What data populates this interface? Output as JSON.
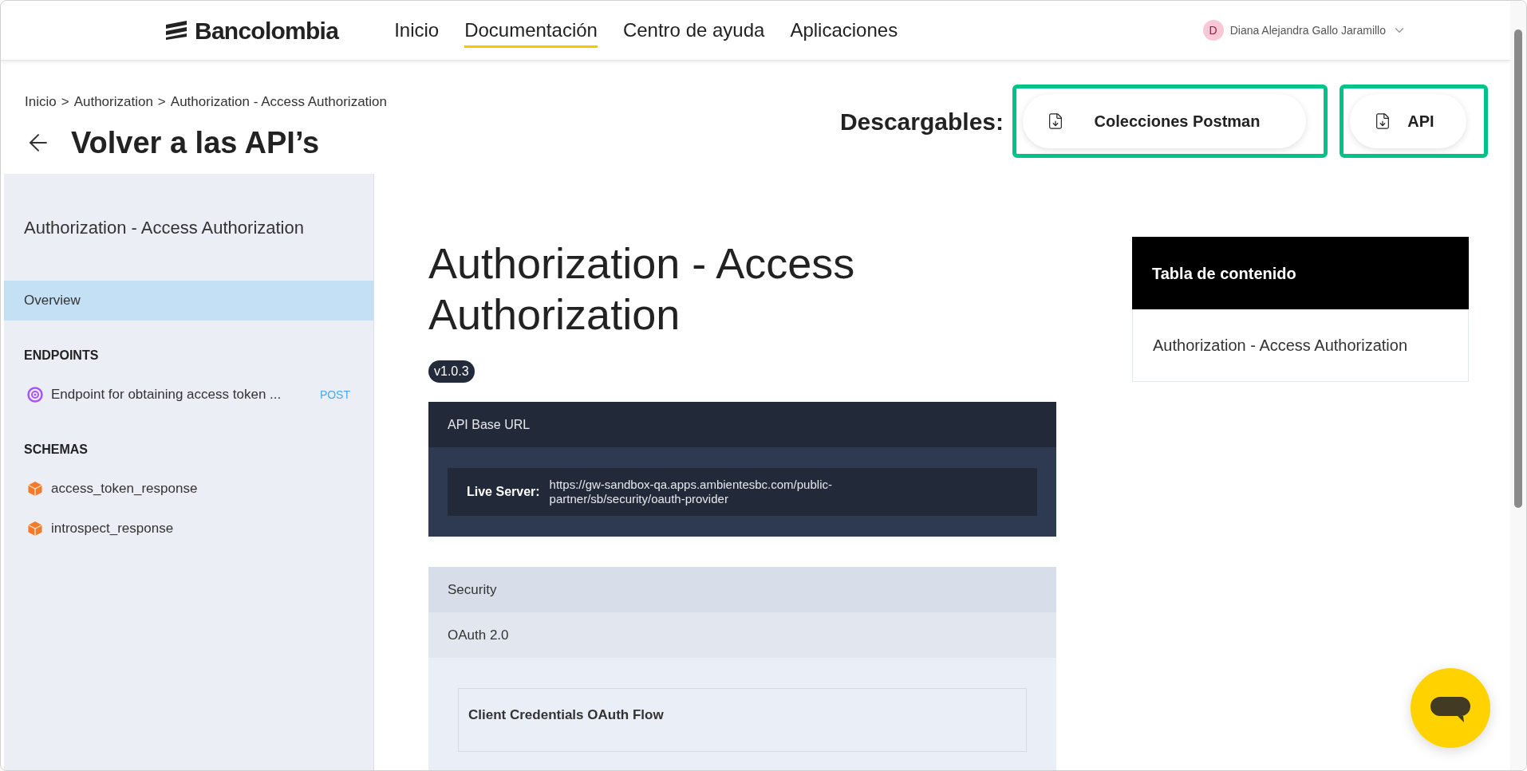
{
  "logo": "Bancolombia",
  "nav": [
    {
      "label": "Inicio",
      "selected": false
    },
    {
      "label": "Documentación",
      "selected": true
    },
    {
      "label": "Centro de ayuda",
      "selected": false
    },
    {
      "label": "Aplicaciones",
      "selected": false
    }
  ],
  "user": {
    "initial": "D",
    "name": "Diana Alejandra Gallo Jaramillo"
  },
  "breadcrumb": {
    "separator": ">",
    "items": [
      "Inicio",
      "Authorization",
      "Authorization - Access Authorization"
    ]
  },
  "back_title": "Volver a las API’s",
  "downloads": {
    "label": "Descargables:",
    "buttons": [
      "Colecciones Postman",
      "API"
    ]
  },
  "sidebar": {
    "title": "Authorization - Access Authorization",
    "sections": [
      {
        "items": [
          {
            "kind": "page",
            "label": "Overview",
            "selected": true
          }
        ]
      },
      {
        "heading": "ENDPOINTS",
        "items": [
          {
            "kind": "endpoint",
            "label": "Endpoint for obtaining access token ...",
            "method": "POST",
            "selected": false
          }
        ]
      },
      {
        "heading": "SCHEMAS",
        "items": [
          {
            "kind": "schema",
            "label": "access_token_response",
            "selected": false
          },
          {
            "kind": "schema",
            "label": "introspect_response",
            "selected": false
          }
        ]
      }
    ]
  },
  "main": {
    "title": "Authorization - Access Authorization",
    "version": "v1.0.3",
    "base_url": {
      "title": "API Base URL",
      "server_label": "Live Server:",
      "url": "https://gw-sandbox-qa.apps.ambientesbc.com/public-partner/sb/security/oauth-provider"
    },
    "security": {
      "title": "Security",
      "scheme": "OAuth 2.0",
      "flow": "Client Credentials OAuth Flow"
    }
  },
  "toc": {
    "title": "Tabla de contenido",
    "items": [
      "Authorization - Access Authorization"
    ]
  }
}
